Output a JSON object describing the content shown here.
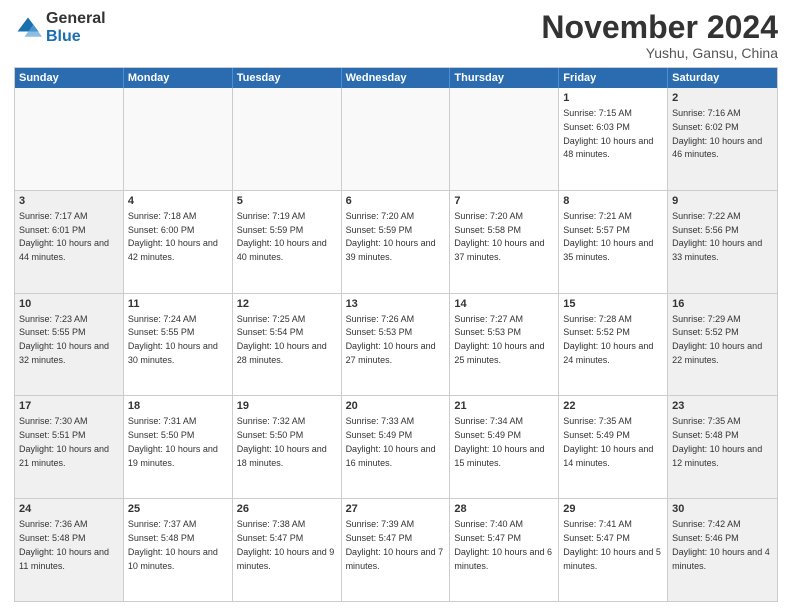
{
  "header": {
    "logo_general": "General",
    "logo_blue": "Blue",
    "month_title": "November 2024",
    "location": "Yushu, Gansu, China"
  },
  "days_of_week": [
    "Sunday",
    "Monday",
    "Tuesday",
    "Wednesday",
    "Thursday",
    "Friday",
    "Saturday"
  ],
  "weeks": [
    [
      {
        "day": "",
        "info": ""
      },
      {
        "day": "",
        "info": ""
      },
      {
        "day": "",
        "info": ""
      },
      {
        "day": "",
        "info": ""
      },
      {
        "day": "",
        "info": ""
      },
      {
        "day": "1",
        "info": "Sunrise: 7:15 AM\nSunset: 6:03 PM\nDaylight: 10 hours and 48 minutes."
      },
      {
        "day": "2",
        "info": "Sunrise: 7:16 AM\nSunset: 6:02 PM\nDaylight: 10 hours and 46 minutes."
      }
    ],
    [
      {
        "day": "3",
        "info": "Sunrise: 7:17 AM\nSunset: 6:01 PM\nDaylight: 10 hours and 44 minutes."
      },
      {
        "day": "4",
        "info": "Sunrise: 7:18 AM\nSunset: 6:00 PM\nDaylight: 10 hours and 42 minutes."
      },
      {
        "day": "5",
        "info": "Sunrise: 7:19 AM\nSunset: 5:59 PM\nDaylight: 10 hours and 40 minutes."
      },
      {
        "day": "6",
        "info": "Sunrise: 7:20 AM\nSunset: 5:59 PM\nDaylight: 10 hours and 39 minutes."
      },
      {
        "day": "7",
        "info": "Sunrise: 7:20 AM\nSunset: 5:58 PM\nDaylight: 10 hours and 37 minutes."
      },
      {
        "day": "8",
        "info": "Sunrise: 7:21 AM\nSunset: 5:57 PM\nDaylight: 10 hours and 35 minutes."
      },
      {
        "day": "9",
        "info": "Sunrise: 7:22 AM\nSunset: 5:56 PM\nDaylight: 10 hours and 33 minutes."
      }
    ],
    [
      {
        "day": "10",
        "info": "Sunrise: 7:23 AM\nSunset: 5:55 PM\nDaylight: 10 hours and 32 minutes."
      },
      {
        "day": "11",
        "info": "Sunrise: 7:24 AM\nSunset: 5:55 PM\nDaylight: 10 hours and 30 minutes."
      },
      {
        "day": "12",
        "info": "Sunrise: 7:25 AM\nSunset: 5:54 PM\nDaylight: 10 hours and 28 minutes."
      },
      {
        "day": "13",
        "info": "Sunrise: 7:26 AM\nSunset: 5:53 PM\nDaylight: 10 hours and 27 minutes."
      },
      {
        "day": "14",
        "info": "Sunrise: 7:27 AM\nSunset: 5:53 PM\nDaylight: 10 hours and 25 minutes."
      },
      {
        "day": "15",
        "info": "Sunrise: 7:28 AM\nSunset: 5:52 PM\nDaylight: 10 hours and 24 minutes."
      },
      {
        "day": "16",
        "info": "Sunrise: 7:29 AM\nSunset: 5:52 PM\nDaylight: 10 hours and 22 minutes."
      }
    ],
    [
      {
        "day": "17",
        "info": "Sunrise: 7:30 AM\nSunset: 5:51 PM\nDaylight: 10 hours and 21 minutes."
      },
      {
        "day": "18",
        "info": "Sunrise: 7:31 AM\nSunset: 5:50 PM\nDaylight: 10 hours and 19 minutes."
      },
      {
        "day": "19",
        "info": "Sunrise: 7:32 AM\nSunset: 5:50 PM\nDaylight: 10 hours and 18 minutes."
      },
      {
        "day": "20",
        "info": "Sunrise: 7:33 AM\nSunset: 5:49 PM\nDaylight: 10 hours and 16 minutes."
      },
      {
        "day": "21",
        "info": "Sunrise: 7:34 AM\nSunset: 5:49 PM\nDaylight: 10 hours and 15 minutes."
      },
      {
        "day": "22",
        "info": "Sunrise: 7:35 AM\nSunset: 5:49 PM\nDaylight: 10 hours and 14 minutes."
      },
      {
        "day": "23",
        "info": "Sunrise: 7:35 AM\nSunset: 5:48 PM\nDaylight: 10 hours and 12 minutes."
      }
    ],
    [
      {
        "day": "24",
        "info": "Sunrise: 7:36 AM\nSunset: 5:48 PM\nDaylight: 10 hours and 11 minutes."
      },
      {
        "day": "25",
        "info": "Sunrise: 7:37 AM\nSunset: 5:48 PM\nDaylight: 10 hours and 10 minutes."
      },
      {
        "day": "26",
        "info": "Sunrise: 7:38 AM\nSunset: 5:47 PM\nDaylight: 10 hours and 9 minutes."
      },
      {
        "day": "27",
        "info": "Sunrise: 7:39 AM\nSunset: 5:47 PM\nDaylight: 10 hours and 7 minutes."
      },
      {
        "day": "28",
        "info": "Sunrise: 7:40 AM\nSunset: 5:47 PM\nDaylight: 10 hours and 6 minutes."
      },
      {
        "day": "29",
        "info": "Sunrise: 7:41 AM\nSunset: 5:47 PM\nDaylight: 10 hours and 5 minutes."
      },
      {
        "day": "30",
        "info": "Sunrise: 7:42 AM\nSunset: 5:46 PM\nDaylight: 10 hours and 4 minutes."
      }
    ]
  ]
}
